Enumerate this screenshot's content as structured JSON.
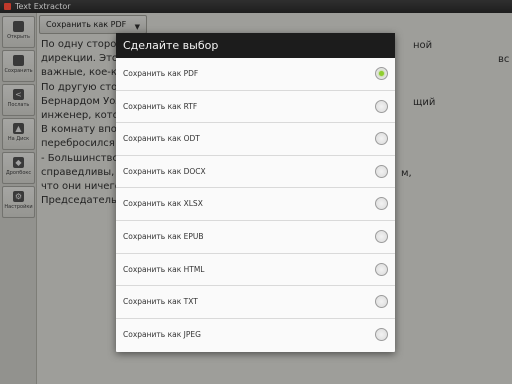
{
  "window": {
    "title": "Text Extractor"
  },
  "sidebar": {
    "items": [
      {
        "label": "Открыть",
        "icon": "folder-open-icon"
      },
      {
        "label": "Сохранить",
        "icon": "save-icon"
      },
      {
        "label": "Послать",
        "icon": "share-icon"
      },
      {
        "label": "На Диск",
        "icon": "google-drive-icon"
      },
      {
        "label": "Дропбокс",
        "icon": "dropbox-icon"
      },
      {
        "label": "Настройки",
        "icon": "settings-icon"
      }
    ]
  },
  "format_select": {
    "value": "Сохранить как PDF"
  },
  "document": {
    "lines": [
      "    По одну сторону",
      "дирекции. Это б",
      "важные, кое-кто",
      "    По другую стор",
      "Бернардом Уолл",
      "инженер, которо",
      "    В комнату впор",
      "перебросился не",
      "    - Большинство",
      "справедливы, и т",
      "что они ничего н",
      "    Председатель"
    ],
    "right_fragments": [
      "ной",
      "все",
      "щий",
      "м,"
    ]
  },
  "dialog": {
    "title": "Сделайте выбор",
    "selected_index": 0,
    "options": [
      "Сохранить как PDF",
      "Сохранить как RTF",
      "Сохранить как ODT",
      "Сохранить как DOCX",
      "Сохранить как XLSX",
      "Сохранить как EPUB",
      "Сохранить как HTML",
      "Сохранить как TXT",
      "Сохранить как JPEG"
    ]
  },
  "colors": {
    "accent_radio": "#8fce2e",
    "dialog_title_bg": "#1c1c1c"
  }
}
